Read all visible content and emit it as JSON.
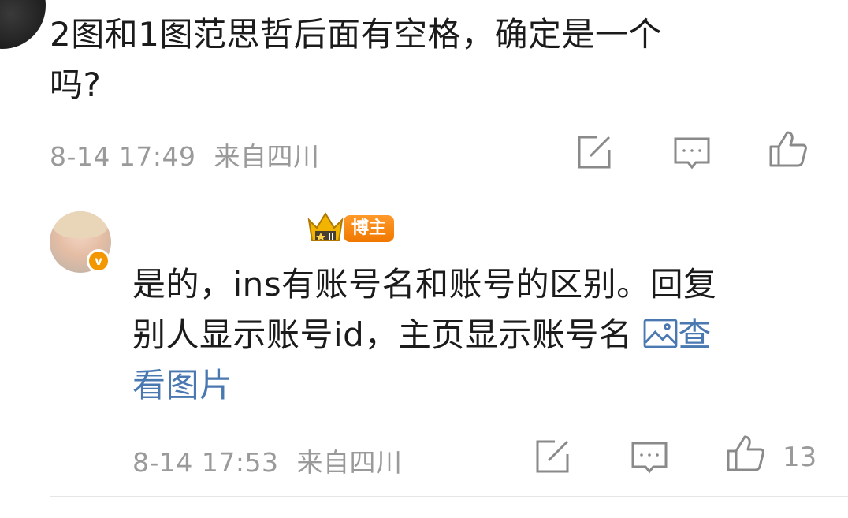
{
  "comment1": {
    "text_line1": "2图和1图范思哲后面有空格，确定是一个",
    "text_line2": "吗?",
    "time": "8-14 17:49",
    "location": "来自四川"
  },
  "reply": {
    "badge_label": "博主",
    "verify_mark": "v",
    "text_line1": "是的，ins有账号名和账号的区别。回复",
    "text_line2_main": "别人显示账号id，主页显示账号名",
    "view_image_part1": "查",
    "view_image_part2": "看图片",
    "time": "8-14 17:53",
    "location": "来自四川",
    "like_count": "13"
  },
  "colors": {
    "meta_gray": "#9a9a9a",
    "link_blue": "#4a79b2",
    "badge_orange": "#f07800"
  },
  "icons": [
    "edit-icon",
    "comment-icon",
    "like-icon",
    "image-icon",
    "crown-icon"
  ]
}
